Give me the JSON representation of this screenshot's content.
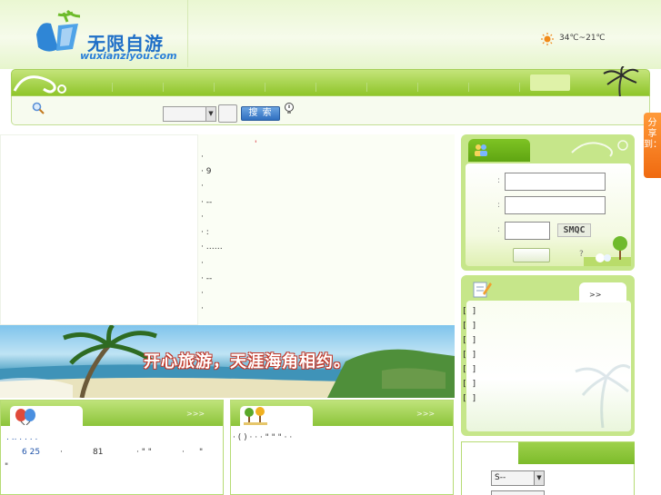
{
  "header": {
    "logo_text": "无限自游",
    "logo_url": "wuxianziyou.com",
    "weather": "34℃~21℃"
  },
  "search": {
    "button_label": "搜 索"
  },
  "news": {
    "items": [
      {
        "text": "'",
        "color": "#d4202a"
      },
      {
        "text": "·"
      },
      {
        "text": "·                      9"
      },
      {
        "text": "·"
      },
      {
        "text": "·    --"
      },
      {
        "text": "·"
      },
      {
        "text": "·              :"
      },
      {
        "text": "·              ……"
      },
      {
        "text": "·"
      },
      {
        "text": "·   --"
      },
      {
        "text": "·"
      },
      {
        "text": "·"
      }
    ]
  },
  "banner": {
    "slogan": "开心旅游，天涯海角相约。"
  },
  "box_left": {
    "more": ">>>",
    "line1": ".  ..        .                .             .            .",
    "line2_a": "6 25",
    "line2_b": "·",
    "line2_c": "81",
    "line2_d": "·  \"  \"",
    "line2_e": "·",
    "line2_f": "\"",
    "line3": "\""
  },
  "box_right": {
    "more": ">>>",
    "line1": "·   ( )    ·       ·      ·   \"  \" \"   ·           ·"
  },
  "login": {
    "colon": ":",
    "captcha": "SMQC",
    "question": "?"
  },
  "notice": {
    "more": ">>",
    "brackets": [
      "[ ]",
      "[ ]",
      "[ ]",
      "[ ]",
      "[ ]",
      "[ ]",
      "[ ]"
    ]
  },
  "weather_box": {
    "city": "S--"
  },
  "share": {
    "label": "分享到："
  }
}
